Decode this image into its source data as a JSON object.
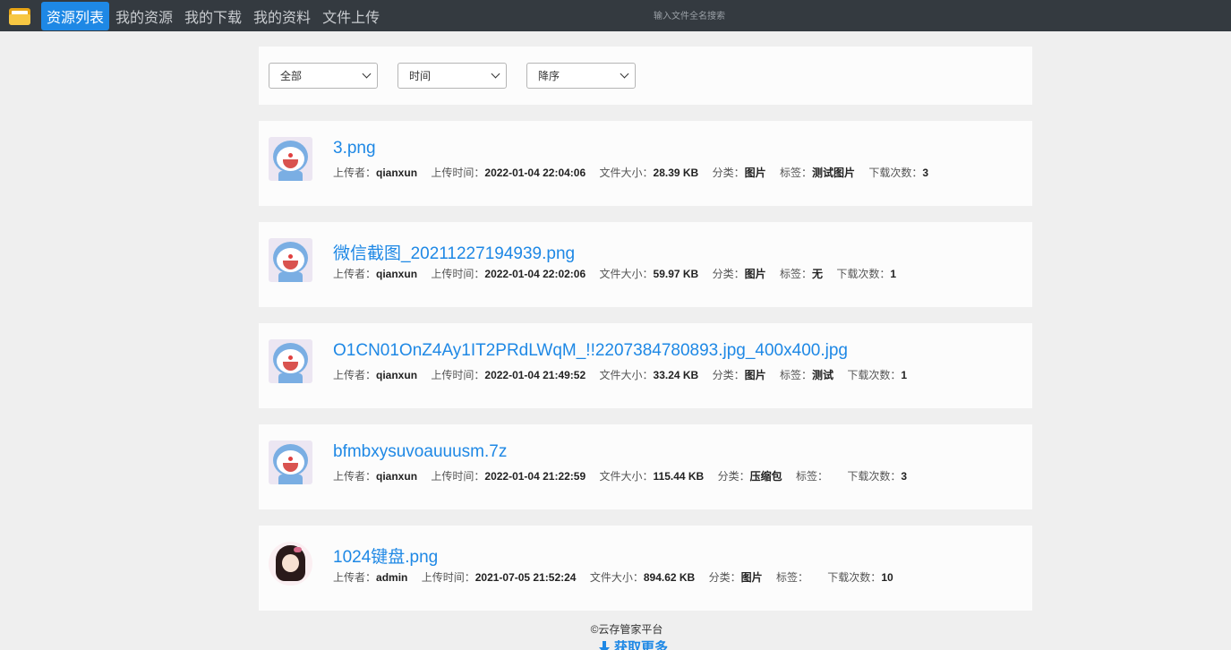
{
  "nav": {
    "items": [
      {
        "label": "资源列表",
        "active": true
      },
      {
        "label": "我的资源",
        "active": false
      },
      {
        "label": "我的下载",
        "active": false
      },
      {
        "label": "我的资料",
        "active": false
      },
      {
        "label": "文件上传",
        "active": false
      }
    ],
    "search_placeholder": "输入文件全名搜索"
  },
  "filters": {
    "category": "全部",
    "sort_by": "时间",
    "order": "降序"
  },
  "labels": {
    "uploader": "上传者：",
    "upload_time": "上传时间：",
    "file_size": "文件大小：",
    "category": "分类：",
    "tags": "标签：",
    "downloads": "下载次数："
  },
  "files": [
    {
      "name": "3.png",
      "uploader": "qianxun",
      "time": "2022-01-04 22:04:06",
      "size": "28.39 KB",
      "category": "图片",
      "tags": "测试图片",
      "downloads": "3",
      "avatar": "doraemon"
    },
    {
      "name": "微信截图_20211227194939.png",
      "uploader": "qianxun",
      "time": "2022-01-04 22:02:06",
      "size": "59.97 KB",
      "category": "图片",
      "tags": "无",
      "downloads": "1",
      "avatar": "doraemon"
    },
    {
      "name": "O1CN01OnZ4Ay1IT2PRdLWqM_!!2207384780893.jpg_400x400.jpg",
      "uploader": "qianxun",
      "time": "2022-01-04 21:49:52",
      "size": "33.24 KB",
      "category": "图片",
      "tags": "测试",
      "downloads": "1",
      "avatar": "doraemon"
    },
    {
      "name": "bfmbxysuvoauuusm.7z",
      "uploader": "qianxun",
      "time": "2022-01-04 21:22:59",
      "size": "115.44 KB",
      "category": "压缩包",
      "tags": "",
      "downloads": "3",
      "avatar": "doraemon"
    },
    {
      "name": "1024键盘.png",
      "uploader": "admin",
      "time": "2021-07-05 21:52:24",
      "size": "894.62 KB",
      "category": "图片",
      "tags": "",
      "downloads": "10",
      "avatar": "girl"
    }
  ],
  "footer": {
    "copyright": "©云存管家平台",
    "load_more": "获取更多"
  },
  "colors": {
    "accent": "#1e88e5",
    "navbar": "#343a40"
  }
}
